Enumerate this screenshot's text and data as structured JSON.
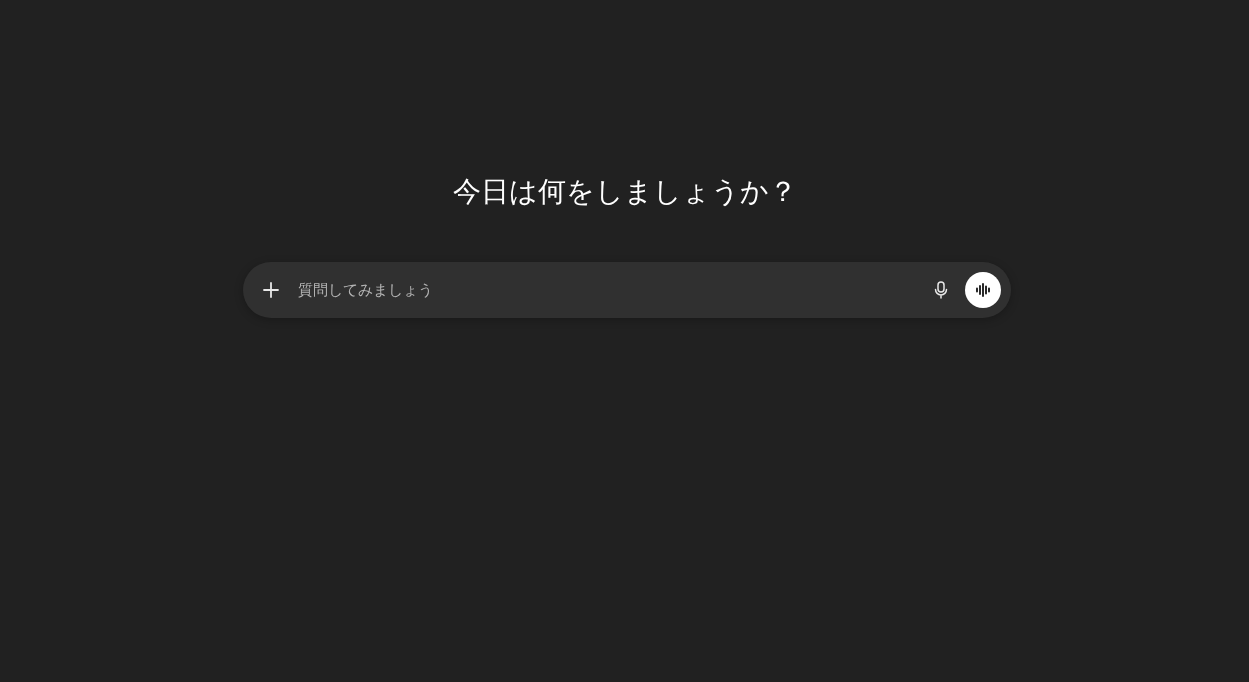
{
  "heading": "今日は何をしましょうか？",
  "composer": {
    "placeholder": "質問してみましょう"
  }
}
